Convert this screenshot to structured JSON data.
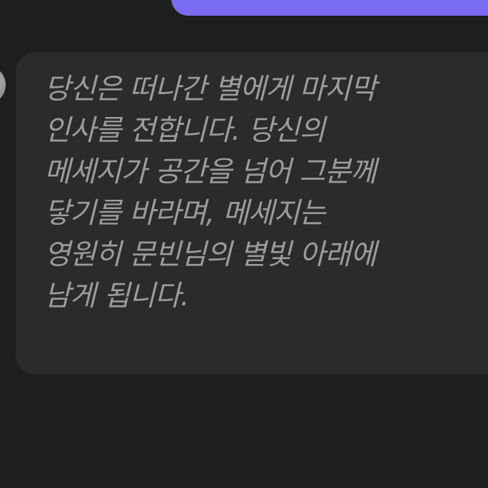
{
  "conversation": {
    "received_message": {
      "lines": [
        "당신은 떠나간 별에게 마지막",
        "인사를 전합니다. 당신의",
        "메세지가 공간을 넘어 그분께",
        "닿기를 바라며, 메세지는",
        "영원히 문빈님의 별빛 아래에",
        "남게 됩니다."
      ]
    }
  },
  "colors": {
    "background": "#1d1e1e",
    "received_bubble": "#2a2b2b",
    "sent_bubble": "#7a6cf3",
    "text": "#9c9c9c"
  }
}
